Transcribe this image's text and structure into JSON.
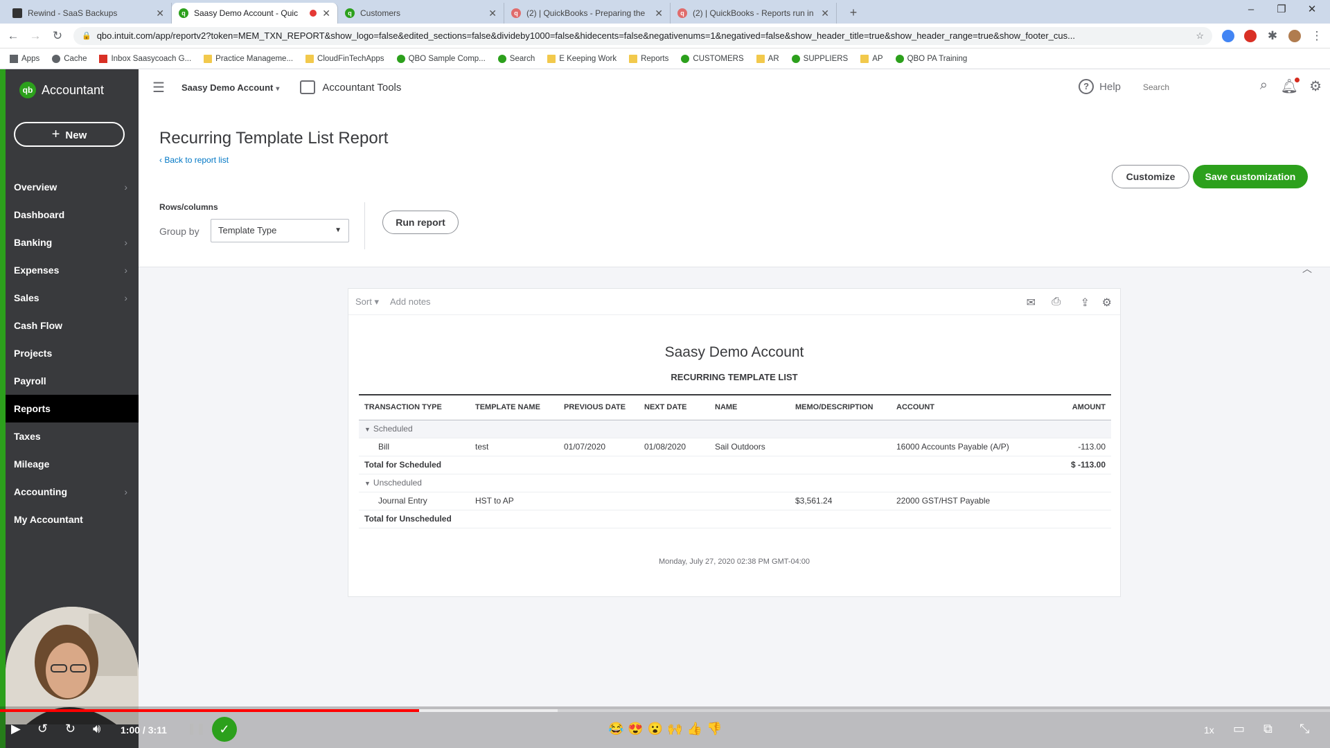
{
  "browser": {
    "tabs": [
      {
        "title": "Rewind - SaaS Backups",
        "icon": "rewind-icon",
        "active": false
      },
      {
        "title": "Saasy Demo Account - Quic",
        "icon": "quickbooks-icon",
        "active": true,
        "recording": true
      },
      {
        "title": "Customers",
        "icon": "quickbooks-icon",
        "active": false
      },
      {
        "title": "(2) | QuickBooks - Preparing the",
        "icon": "quickbooks-icon",
        "active": false
      },
      {
        "title": "(2) | QuickBooks - Reports run in",
        "icon": "quickbooks-icon",
        "active": false
      }
    ],
    "new_tab": "+",
    "url": "qbo.intuit.com/app/reportv2?token=MEM_TXN_REPORT&show_logo=false&edited_sections=false&divideby1000=false&hidecents=false&negativenums=1&negatived=false&show_header_title=true&show_header_range=true&show_footer_cus...",
    "bookmarks": [
      "Apps",
      "Cache",
      "Inbox Saasycoach G...",
      "Practice Manageme...",
      "CloudFinTechApps",
      "QBO Sample Comp...",
      "Search",
      "E Keeping Work",
      "Reports",
      "CUSTOMERS",
      "AR",
      "SUPPLIERS",
      "AP",
      "QBO PA Training"
    ]
  },
  "sidebar": {
    "logo_text": "Accountant",
    "logo_badge": "qb",
    "new_label": "New",
    "items": [
      {
        "label": "Overview",
        "chevron": true
      },
      {
        "label": "Dashboard",
        "chevron": false
      },
      {
        "label": "Banking",
        "chevron": true
      },
      {
        "label": "Expenses",
        "chevron": true
      },
      {
        "label": "Sales",
        "chevron": true
      },
      {
        "label": "Cash Flow",
        "chevron": false
      },
      {
        "label": "Projects",
        "chevron": false
      },
      {
        "label": "Payroll",
        "chevron": false
      },
      {
        "label": "Reports",
        "chevron": false,
        "active": true
      },
      {
        "label": "Taxes",
        "chevron": false
      },
      {
        "label": "Mileage",
        "chevron": false
      },
      {
        "label": "Accounting",
        "chevron": true
      },
      {
        "label": "My Accountant",
        "chevron": false
      }
    ]
  },
  "topbar": {
    "company": "Saasy Demo Account",
    "tools": "Accountant Tools",
    "help": "Help",
    "search_placeholder": "Search"
  },
  "page": {
    "title": "Recurring Template List Report",
    "back_link": "Back to report list",
    "customize": "Customize",
    "save_customization": "Save customization",
    "rows_columns": "Rows/columns",
    "group_by_label": "Group by",
    "group_by_value": "Template Type",
    "run_report": "Run report"
  },
  "report": {
    "sort": "Sort",
    "add_notes": "Add notes",
    "company": "Saasy Demo Account",
    "title": "RECURRING TEMPLATE LIST",
    "columns": [
      "TRANSACTION TYPE",
      "TEMPLATE NAME",
      "PREVIOUS DATE",
      "NEXT DATE",
      "NAME",
      "MEMO/DESCRIPTION",
      "ACCOUNT",
      "AMOUNT"
    ],
    "groups": [
      {
        "label": "Scheduled",
        "rows": [
          {
            "type": "Bill",
            "template": "test",
            "prev": "01/07/2020",
            "next": "01/08/2020",
            "name": "Sail Outdoors",
            "memo": "",
            "account": "16000 Accounts Payable (A/P)",
            "amount": "-113.00"
          }
        ],
        "total_label": "Total for Scheduled",
        "total": "$ -113.00"
      },
      {
        "label": "Unscheduled",
        "rows": [
          {
            "type": "Journal Entry",
            "template": "HST to AP",
            "prev": "",
            "next": "",
            "name": "",
            "memo": "$3,561.24",
            "account": "22000 GST/HST Payable",
            "amount": ""
          }
        ],
        "total_label": "Total for Unscheduled",
        "total": ""
      }
    ],
    "footer_date": "Monday, July 27, 2020   02:38 PM GMT-04:00"
  },
  "video": {
    "time": "1:00 / 3:11",
    "speed": "1x",
    "progress_played": 0.315,
    "emojis": "😂😍😮🙌👍👎"
  }
}
